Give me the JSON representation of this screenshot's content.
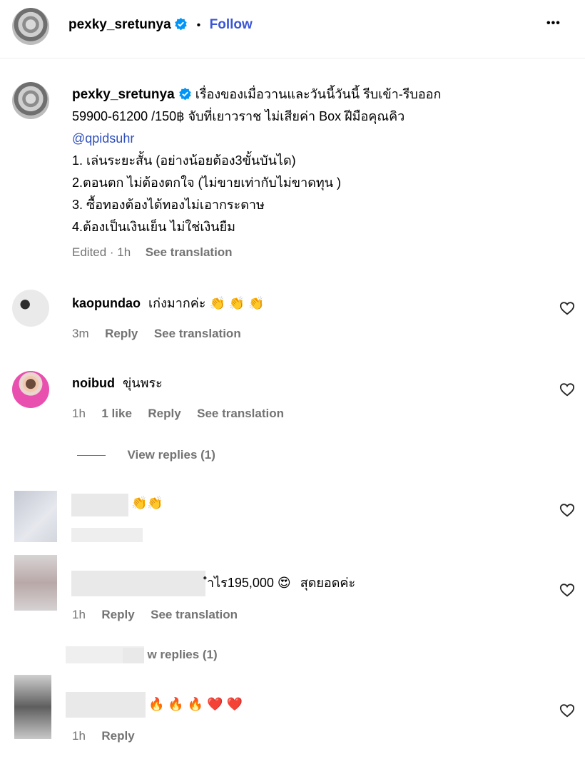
{
  "post": {
    "username": "pexky_sretunya",
    "follow_label": "Follow",
    "dot": "•",
    "more": "•••"
  },
  "caption": {
    "username": "pexky_sretunya",
    "line1": "เรื่องของเมื่อวานและวันนี้วันนี้ รีบเข้า-รีบออก",
    "line2": "59900-61200 /150฿ จับที่เยาวราช ไม่เสียค่า Box ฝีมือคุณคิว",
    "mention": "@qpidsuhr",
    "line4": "1. เล่นระยะสั้น (อย่างน้อยต้อง3ขั้นบันได)",
    "line5": "2.ตอนตก ไม่ต้องตกใจ (ไม่ขายเท่ากับไม่ขาดทุน )",
    "line6": "3. ซื้อทองต้องได้ทองไม่เอากระดาษ",
    "line7": "4.ต้องเป็นเงินเย็น ไม่ใช่เงินยืม",
    "meta": "Edited · 1h",
    "see_translation": "See translation"
  },
  "comments": [
    {
      "username": "kaopundao",
      "text": "เก่งมากค่ะ",
      "emoji": "👏 👏 👏",
      "time": "3m",
      "reply": "Reply",
      "see_translation": "See translation"
    },
    {
      "username": "noibud",
      "text": "ขุ่นพระ",
      "time": "1h",
      "likes": "1 like",
      "reply": "Reply",
      "see_translation": "See translation",
      "view_replies": "View replies (1)"
    },
    {
      "emoji": "👏👏"
    },
    {
      "text": "ำไร195,000",
      "emoji_after": "😍",
      "text2": "สุดยอดค่ะ",
      "time": "1h",
      "reply": "Reply",
      "see_translation": "See translation",
      "view_replies_partial": "w replies (1)"
    },
    {
      "emoji": "🔥 🔥 🔥 ❤️ ❤️",
      "time": "1h",
      "reply": "Reply"
    }
  ]
}
